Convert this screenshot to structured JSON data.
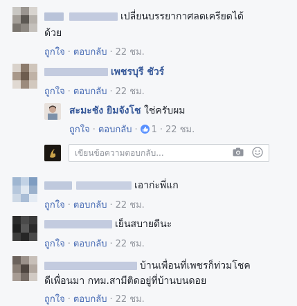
{
  "comments": [
    {
      "text_line1": "เปลี่ยนบรรยากาศลดเครียดได้",
      "text_line2": "ด้วย",
      "like_label": "ถูกใจ",
      "reply_label": "ตอบกลับ",
      "time": "22 ชม."
    },
    {
      "name_visible": "เพชรบุรี ชัวร์",
      "like_label": "ถูกใจ",
      "reply_label": "ตอบกลับ",
      "time": "22 ชม.",
      "reply": {
        "name": "สะมะชัง ยิมจังโช",
        "text": "ใช่ครับผม",
        "like_label": "ถูกใจ",
        "reply_label": "ตอบกลับ",
        "reaction_count": "1",
        "time": "22 ชม."
      },
      "reply_input_placeholder": "เขียนข้อความตอบกลับ..."
    },
    {
      "text": "เอาก่ะพี่แก",
      "like_label": "ถูกใจ",
      "reply_label": "ตอบกลับ",
      "time": "22 ชม."
    },
    {
      "text": "เย็นสบายดีนะ",
      "like_label": "ถูกใจ",
      "reply_label": "ตอบกลับ",
      "time": "22 ชม."
    },
    {
      "text_line1": "บ้านเพื่อนที่เพชรก็ท่วมโชค",
      "text_line2": "ดีเพื่อนมา กทม.สามีติดอยู่ที่บ้านบนดอย",
      "like_label": "ถูกใจ",
      "reply_label": "ตอบกลับ",
      "time": "22 ชม."
    }
  ],
  "colors": {
    "link": "#4267b2",
    "name": "#365899",
    "meta": "#90949c",
    "background": "#f6f7f9"
  }
}
